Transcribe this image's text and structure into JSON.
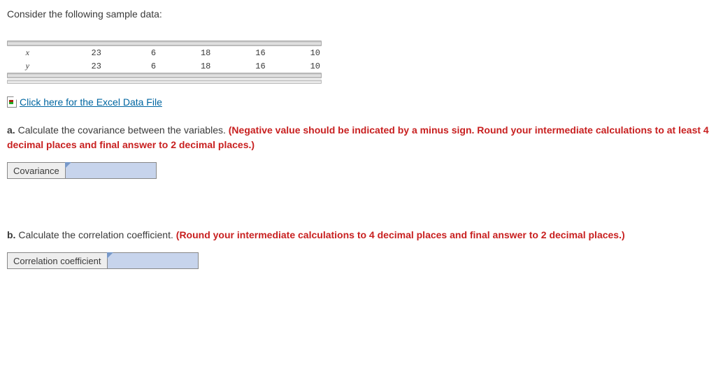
{
  "intro": "Consider the following sample data:",
  "table": {
    "row_x_label": "x",
    "row_y_label": "y",
    "x": [
      "23",
      "6",
      "18",
      "16",
      "10"
    ],
    "y": [
      "23",
      "6",
      "18",
      "16",
      "10"
    ]
  },
  "excel_link": "Click here for the Excel Data File",
  "qa": {
    "label": "a.",
    "text": "Calculate the covariance between the variables.",
    "hint": "(Negative value should be indicated by a minus sign. Round your intermediate calculations to at least 4 decimal places and final answer to 2 decimal places.)",
    "answer_label": "Covariance"
  },
  "qb": {
    "label": "b.",
    "text": "Calculate the correlation coefficient.",
    "hint": "(Round your intermediate calculations to 4 decimal places and final answer to 2 decimal places.)",
    "answer_label": "Correlation coefficient"
  }
}
